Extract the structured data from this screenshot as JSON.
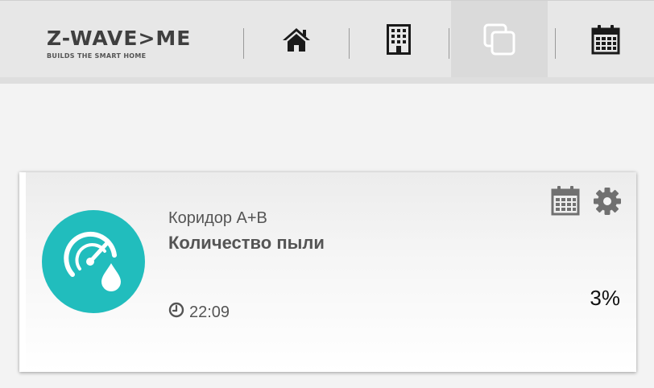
{
  "header": {
    "logo_text": "Z-WAVE>ME",
    "logo_tagline": "BUILDS THE SMART HOME",
    "nav": [
      {
        "icon": "home-icon",
        "active": false
      },
      {
        "icon": "building-icon",
        "active": false
      },
      {
        "icon": "clone-icon",
        "active": true
      },
      {
        "icon": "calendar-icon",
        "active": false
      }
    ]
  },
  "widget": {
    "location": "Коридор A+B",
    "title": "Количество пыли",
    "time": "22:09",
    "value": "3%",
    "icon": "dust-sensor-icon",
    "icon_color": "#21bdbd",
    "actions": [
      {
        "icon": "calendar-icon"
      },
      {
        "icon": "gear-icon"
      }
    ]
  }
}
